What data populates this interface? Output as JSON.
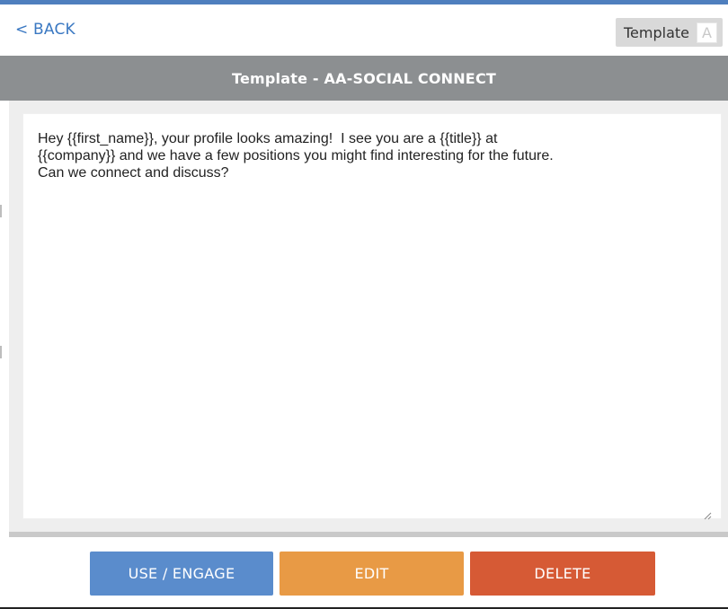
{
  "topbar": {
    "back_label": "< BACK",
    "badge_label": "Template",
    "badge_letter": "A"
  },
  "header": {
    "title": "Template - AA-SOCIAL CONNECT"
  },
  "template": {
    "body": "Hey {{first_name}}, your profile looks amazing!  I see you are a {{title}} at\n{{company}} and we have a few positions you might find interesting for the future.\nCan we connect and discuss?"
  },
  "actions": {
    "use_label": "USE / ENGAGE",
    "edit_label": "EDIT",
    "delete_label": "DELETE"
  },
  "colors": {
    "accent": "#4f7fbe",
    "title_bar": "#8c8f91",
    "use_button": "#5a8ccc",
    "edit_button": "#e89a45",
    "delete_button": "#d65a35"
  },
  "icons": {
    "resize": "resize-grip-icon"
  }
}
